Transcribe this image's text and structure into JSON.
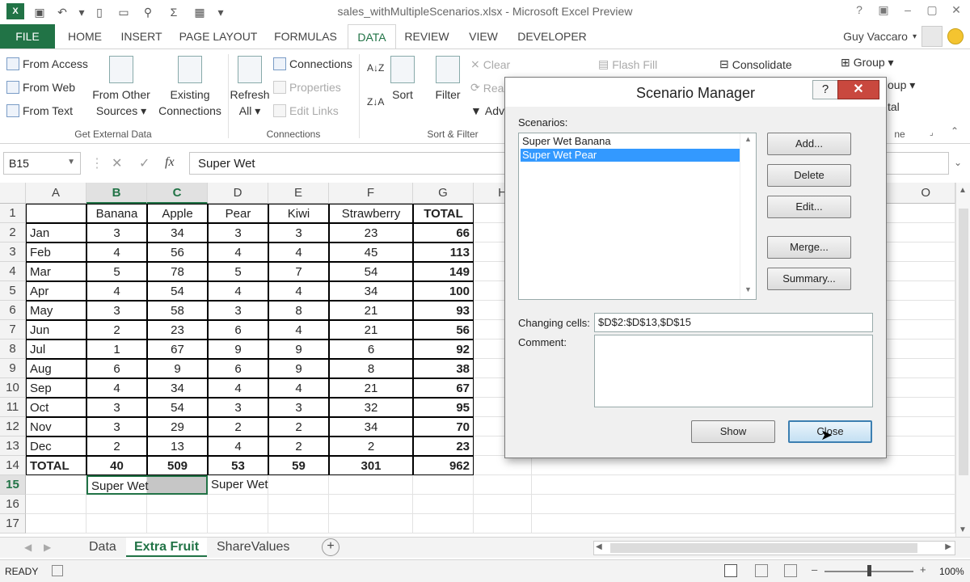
{
  "window": {
    "title": "sales_withMultipleScenarios.xlsx - Microsoft Excel Preview",
    "app_logo": "X",
    "help": "?",
    "minimize": "–",
    "restore": "▢",
    "close": "✕"
  },
  "ribbon_tabs": [
    "FILE",
    "HOME",
    "INSERT",
    "PAGE LAYOUT",
    "FORMULAS",
    "DATA",
    "REVIEW",
    "VIEW",
    "DEVELOPER"
  ],
  "user": {
    "name": "Guy Vaccaro"
  },
  "ribbon": {
    "get_external": {
      "from_access": "From Access",
      "from_web": "From Web",
      "from_text": "From Text",
      "from_other_1": "From Other",
      "from_other_2": "Sources ▾",
      "existing_1": "Existing",
      "existing_2": "Connections",
      "label": "Get External Data"
    },
    "connections": {
      "refresh_1": "Refresh",
      "refresh_2": "All ▾",
      "connections": "Connections",
      "properties": "Properties",
      "edit_links": "Edit Links",
      "label": "Connections"
    },
    "sort_filter": {
      "sort": "Sort",
      "filter": "Filter",
      "clear": "Clear",
      "reapply": "Rea",
      "advanced": "Adv",
      "label": "Sort & Filter"
    },
    "data_tools": {
      "flash_fill": "Flash Fill",
      "consolidate": "Consolidate"
    },
    "outline": {
      "group": "Group ▾",
      "ungroup_partial": "oup ▾",
      "subtotal_partial": "tal",
      "label_partial": "ne"
    }
  },
  "formula_bar": {
    "name_box": "B15",
    "cancel": "✕",
    "enter": "✓",
    "fx": "fx",
    "value": "Super Wet"
  },
  "columns": [
    "A",
    "B",
    "C",
    "D",
    "E",
    "F",
    "G",
    "H",
    "O"
  ],
  "rows": [
    "1",
    "2",
    "3",
    "4",
    "5",
    "6",
    "7",
    "8",
    "9",
    "10",
    "11",
    "12",
    "13",
    "14",
    "15",
    "16",
    "17"
  ],
  "table": {
    "headers": [
      "Banana",
      "Apple",
      "Pear",
      "Kiwi",
      "Strawberry",
      "TOTAL"
    ],
    "data": [
      [
        "Jan",
        "3",
        "34",
        "3",
        "3",
        "23",
        "66"
      ],
      [
        "Feb",
        "4",
        "56",
        "4",
        "4",
        "45",
        "113"
      ],
      [
        "Mar",
        "5",
        "78",
        "5",
        "7",
        "54",
        "149"
      ],
      [
        "Apr",
        "4",
        "54",
        "4",
        "4",
        "34",
        "100"
      ],
      [
        "May",
        "3",
        "58",
        "3",
        "8",
        "21",
        "93"
      ],
      [
        "Jun",
        "2",
        "23",
        "6",
        "4",
        "21",
        "56"
      ],
      [
        "Jul",
        "1",
        "67",
        "9",
        "9",
        "6",
        "92"
      ],
      [
        "Aug",
        "6",
        "9",
        "6",
        "9",
        "8",
        "38"
      ],
      [
        "Sep",
        "4",
        "34",
        "4",
        "4",
        "21",
        "67"
      ],
      [
        "Oct",
        "3",
        "54",
        "3",
        "3",
        "32",
        "95"
      ],
      [
        "Nov",
        "3",
        "29",
        "2",
        "2",
        "34",
        "70"
      ],
      [
        "Dec",
        "2",
        "13",
        "4",
        "2",
        "2",
        "23"
      ]
    ],
    "totals": [
      "TOTAL",
      "40",
      "509",
      "53",
      "59",
      "301",
      "962"
    ],
    "row15": {
      "b": "Super Wet",
      "d": "Super Wet"
    }
  },
  "sheets": {
    "tabs": [
      "Data",
      "Extra Fruit",
      "ShareValues"
    ],
    "active": "Extra Fruit",
    "add": "+"
  },
  "status": {
    "ready": "READY",
    "zoom": "100%"
  },
  "dialog": {
    "title": "Scenario Manager",
    "help": "?",
    "close": "✕",
    "scenarios_label": "Scenarios:",
    "scenarios": [
      "Super Wet Banana",
      "Super Wet Pear"
    ],
    "selected": "Super Wet Pear",
    "buttons": {
      "add": "Add...",
      "delete": "Delete",
      "edit": "Edit...",
      "merge": "Merge...",
      "summary": "Summary...",
      "show": "Show",
      "close": "Close"
    },
    "changing_cells_label": "Changing cells:",
    "changing_cells": "$D$2:$D$13,$D$15",
    "comment_label": "Comment:",
    "comment": ""
  },
  "colors": {
    "excel_green": "#217346",
    "selection_blue": "#3399ff",
    "dialog_close_red": "#c9483e"
  }
}
